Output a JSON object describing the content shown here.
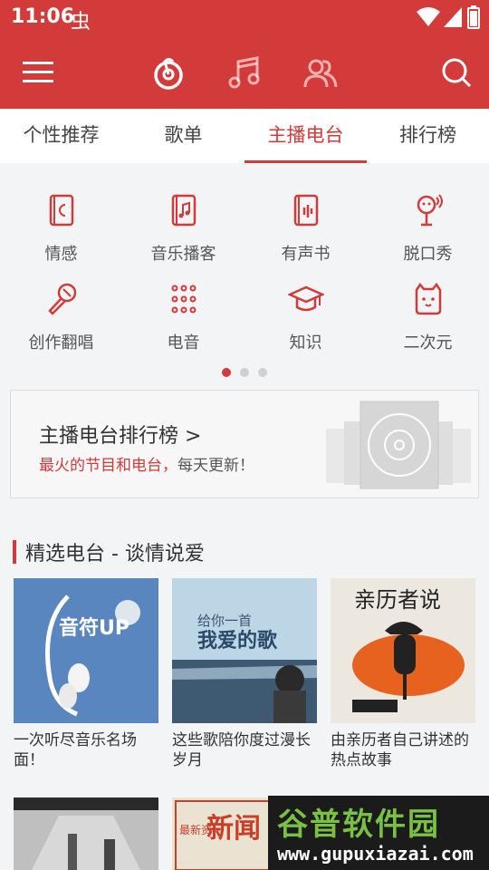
{
  "status_bar": {
    "time": "11:06",
    "notif_icon": "虫"
  },
  "app_bar": {
    "icons": [
      "menu-icon",
      "netease-music-icon",
      "music-note-icon",
      "friends-icon",
      "search-icon"
    ]
  },
  "tabs": [
    {
      "label": "个性推荐"
    },
    {
      "label": "歌单"
    },
    {
      "label": "主播电台",
      "active": true
    },
    {
      "label": "排行榜"
    }
  ],
  "categories": [
    {
      "label": "情感",
      "icon": "moon-book-icon"
    },
    {
      "label": "音乐播客",
      "icon": "music-book-icon"
    },
    {
      "label": "有声书",
      "icon": "audiobook-icon"
    },
    {
      "label": "脱口秀",
      "icon": "talkshow-mic-icon"
    },
    {
      "label": "创作翻唱",
      "icon": "microphone-icon"
    },
    {
      "label": "电音",
      "icon": "dots-grid-icon"
    },
    {
      "label": "知识",
      "icon": "graduation-cap-icon"
    },
    {
      "label": "二次元",
      "icon": "cat-face-icon"
    }
  ],
  "pager": {
    "pages": 3,
    "active": 0
  },
  "rank_card": {
    "title": "主播电台排行榜 >",
    "highlight": "最火的节目和电台，",
    "rest": "每天更新！"
  },
  "section": {
    "title": "精选电台 - 谈情说爱"
  },
  "cards": [
    {
      "caption": "一次听尽音乐名场面！",
      "cover_text": "音符UP"
    },
    {
      "caption": "这些歌陪你度过漫长岁月",
      "cover_text_1": "给你一首",
      "cover_text_2": "我爱的歌"
    },
    {
      "caption": "由亲历者自己讲述的热点故事",
      "cover_text": "亲历者说"
    }
  ],
  "cards_row2": [
    {
      "cover_text": ""
    },
    {
      "cover_text": "新闻",
      "cover_text_side": "最新资"
    }
  ],
  "watermark": {
    "big": "谷普软件园",
    "small": "www.gupuxiazai.com"
  },
  "colors": {
    "brand_red": "#d33a3a",
    "bg": "#f3f4f6"
  }
}
